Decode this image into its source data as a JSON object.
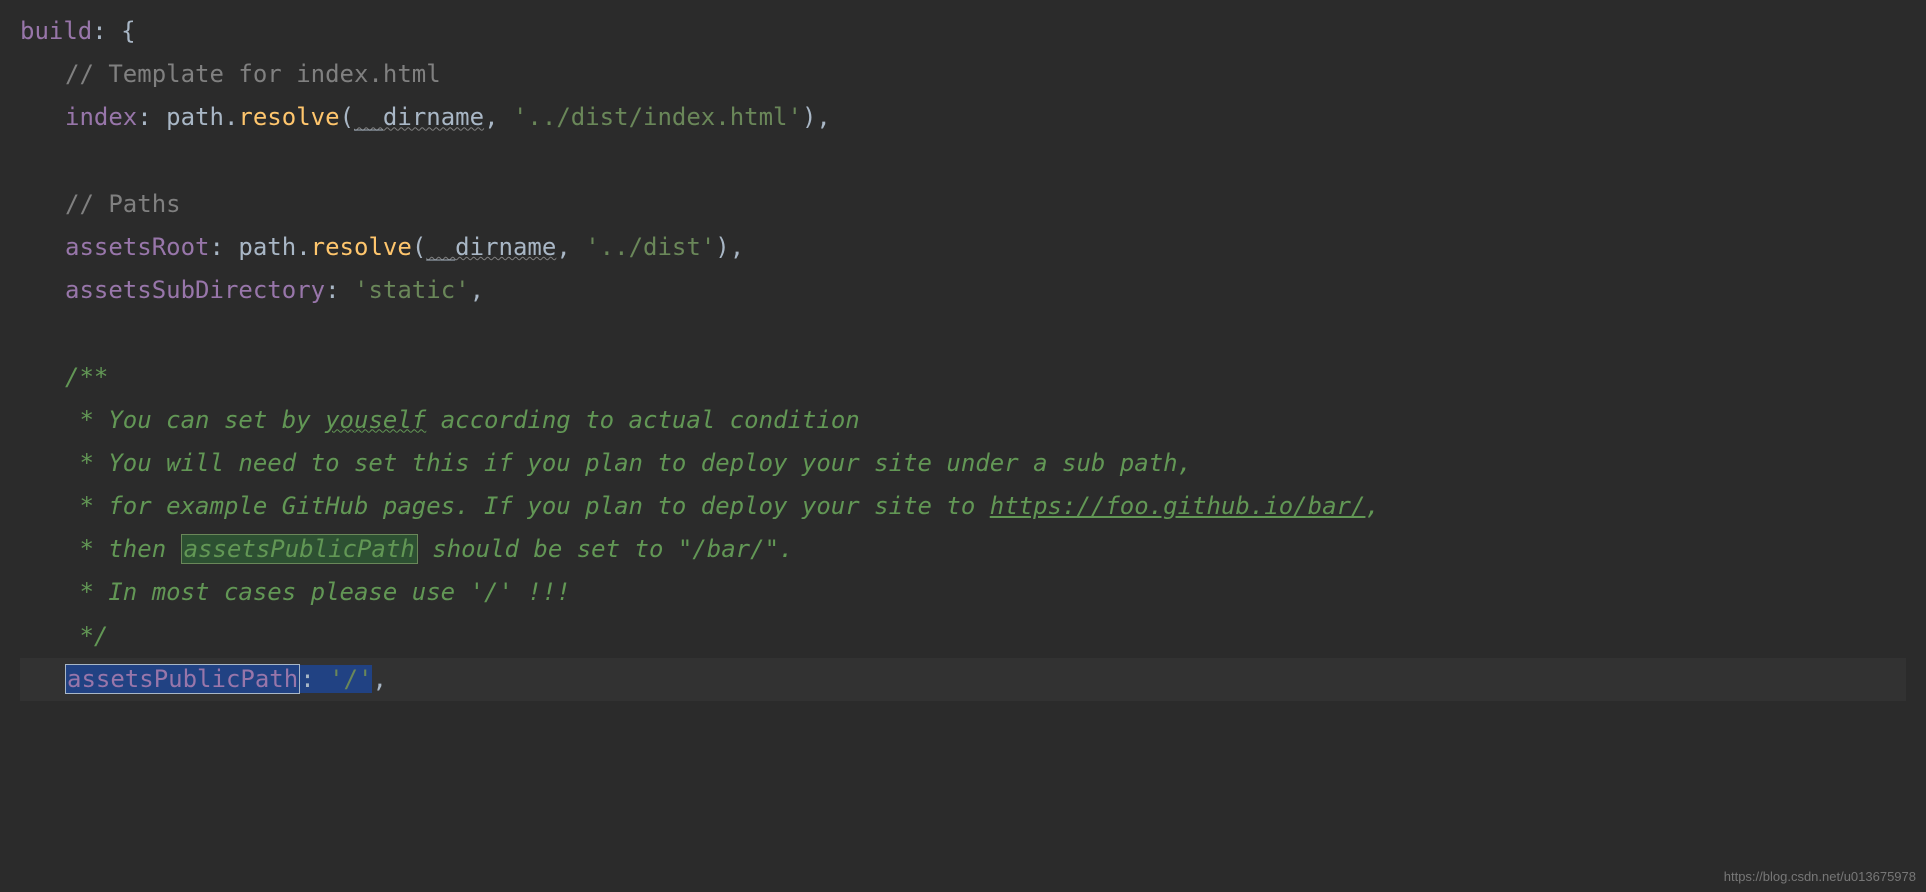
{
  "code": {
    "l1_key": "build",
    "l1_punc": ": {",
    "l2_comment": "// Template for index.html",
    "l3_key": "index",
    "l3_sep": ": ",
    "l3_obj": "path",
    "l3_dot": ".",
    "l3_func": "resolve",
    "l3_open": "(",
    "l3_arg1": "__dirname",
    "l3_comma": ", ",
    "l3_arg2": "'../dist/index.html'",
    "l3_close": "),",
    "l5_comment": "// Paths",
    "l6_key": "assetsRoot",
    "l6_sep": ": ",
    "l6_obj": "path",
    "l6_dot": ".",
    "l6_func": "resolve",
    "l6_open": "(",
    "l6_arg1": "__dirname",
    "l6_comma": ", ",
    "l6_arg2": "'../dist'",
    "l6_close": "),",
    "l7_key": "assetsSubDirectory",
    "l7_sep": ": ",
    "l7_val": "'static'",
    "l7_end": ",",
    "bc1": "/**",
    "bc2a": " * You can set by ",
    "bc2b": "youself",
    "bc2c": " according to actual condition",
    "bc3": " * You will need to set this if you plan to deploy your site under a sub path,",
    "bc4a": " * for example GitHub pages. If you plan to deploy your site to ",
    "bc4b": "https://foo.github.io/bar/",
    "bc4c": ",",
    "bc5a": " * then ",
    "bc5b": "assetsPublicPath",
    "bc5c": " should be set to \"/bar/\".",
    "bc6": " * In most cases please use '/' !!!",
    "bc7": " */",
    "l15_key": "assetsPublicPath",
    "l15_sep": ": ",
    "l15_val": "'/'",
    "l15_end": ","
  },
  "watermark": "https://blog.csdn.net/u013675978"
}
